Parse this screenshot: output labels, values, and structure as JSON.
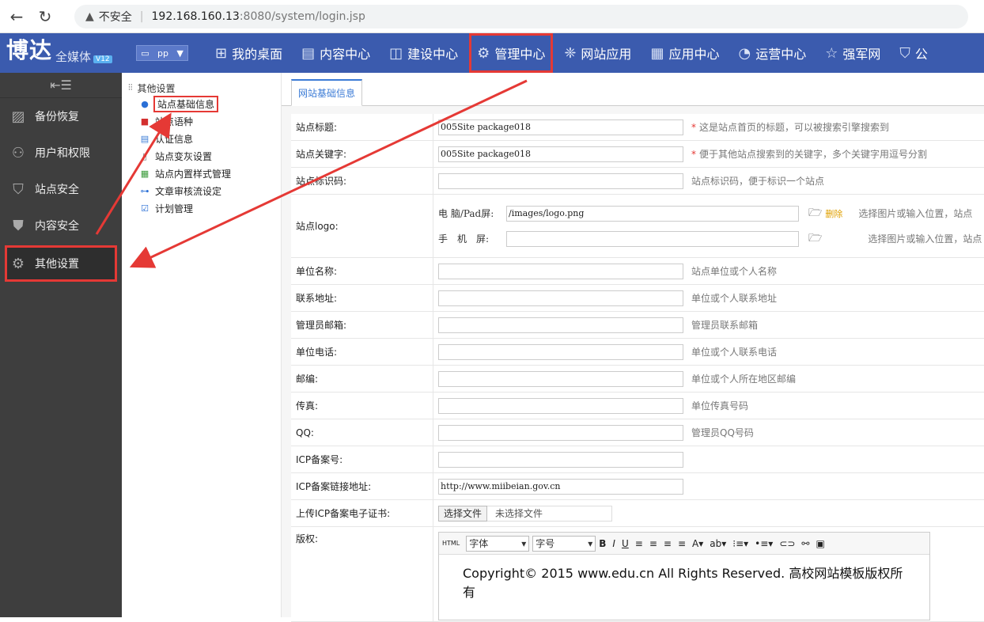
{
  "browser": {
    "back_icon": "arrow-left-icon",
    "reload_icon": "reload-icon",
    "security_warning": "不安全",
    "url_host": "192.168.160.13",
    "url_path": ":8080/system/login.jsp"
  },
  "header": {
    "logo_main": "博达",
    "logo_sub": "全媒体",
    "logo_version": "V12",
    "site_select_value": "pp",
    "nav": [
      {
        "label": "我的桌面",
        "icon": "grid-icon"
      },
      {
        "label": "内容中心",
        "icon": "document-icon"
      },
      {
        "label": "建设中心",
        "icon": "layout-icon"
      },
      {
        "label": "管理中心",
        "icon": "gear-icon",
        "active": true
      },
      {
        "label": "网站应用",
        "icon": "apps-icon"
      },
      {
        "label": "应用中心",
        "icon": "blocks-icon"
      },
      {
        "label": "运营中心",
        "icon": "pie-chart-icon"
      },
      {
        "label": "强军网",
        "icon": "star-icon"
      },
      {
        "label": "公",
        "icon": "shield-icon"
      }
    ]
  },
  "sidebar": {
    "items": [
      {
        "label": "备份恢复",
        "icon": "backup-icon"
      },
      {
        "label": "用户和权限",
        "icon": "user-icon"
      },
      {
        "label": "站点安全",
        "icon": "shield-icon"
      },
      {
        "label": "内容安全",
        "icon": "content-security-icon"
      },
      {
        "label": "其他设置",
        "icon": "gear-icon",
        "active": true
      }
    ]
  },
  "tree": {
    "root": "其他设置",
    "items": [
      {
        "label": "站点基础信息",
        "icon": "globe-icon",
        "active": true
      },
      {
        "label": "站点语种",
        "icon": "flag-icon"
      },
      {
        "label": "认证信息",
        "icon": "certificate-icon"
      },
      {
        "label": "站点变灰设置",
        "icon": "file-icon"
      },
      {
        "label": "站点内置样式管理",
        "icon": "table-icon"
      },
      {
        "label": "文章审核流设定",
        "icon": "flow-icon"
      },
      {
        "label": "计划管理",
        "icon": "checklist-icon"
      }
    ]
  },
  "main": {
    "tab_label": "网站基础信息",
    "fields": [
      {
        "label": "站点标题:",
        "value": "005Site package018",
        "required": true,
        "hint": "这是站点首页的标题，可以被搜索引擎搜索到"
      },
      {
        "label": "站点关键字:",
        "value": "005Site package018",
        "required": true,
        "hint": "便于其他站点搜索到的关键字，多个关键字用逗号分割"
      },
      {
        "label": "站点标识码:",
        "value": "",
        "required": false,
        "hint": "站点标识码，便于标识一个站点"
      }
    ],
    "logo": {
      "label": "站点logo:",
      "pc_label": "电 脑/Pad屏:",
      "pc_value": "/images/logo.png",
      "delete_label": "删除",
      "mobile_label": "手　机　屏:",
      "mobile_value": "",
      "hint": "选择图片或输入位置，站点"
    },
    "fields2": [
      {
        "label": "单位名称:",
        "value": "",
        "hint": "站点单位或个人名称"
      },
      {
        "label": "联系地址:",
        "value": "",
        "hint": "单位或个人联系地址"
      },
      {
        "label": "管理员邮箱:",
        "value": "",
        "hint": "管理员联系邮箱"
      },
      {
        "label": "单位电话:",
        "value": "",
        "hint": "单位或个人联系电话"
      },
      {
        "label": "邮编:",
        "value": "",
        "hint": "单位或个人所在地区邮编"
      },
      {
        "label": "传真:",
        "value": "",
        "hint": "单位传真号码"
      },
      {
        "label": "QQ:",
        "value": "",
        "hint": "管理员QQ号码"
      },
      {
        "label": "ICP备案号:",
        "value": "",
        "hint": ""
      },
      {
        "label": "ICP备案链接地址:",
        "value": "http://www.miibeian.gov.cn",
        "hint": ""
      }
    ],
    "upload": {
      "label": "上传ICP备案电子证书:",
      "button": "选择文件",
      "status": "未选择文件"
    },
    "copyright": {
      "label": "版权:",
      "toolbar_html": "HTML",
      "font_select": "字体",
      "size_select": "字号",
      "content": "Copyright© 2015 www.edu.cn All Rights Reserved. 高校网站模板版权所有"
    }
  }
}
